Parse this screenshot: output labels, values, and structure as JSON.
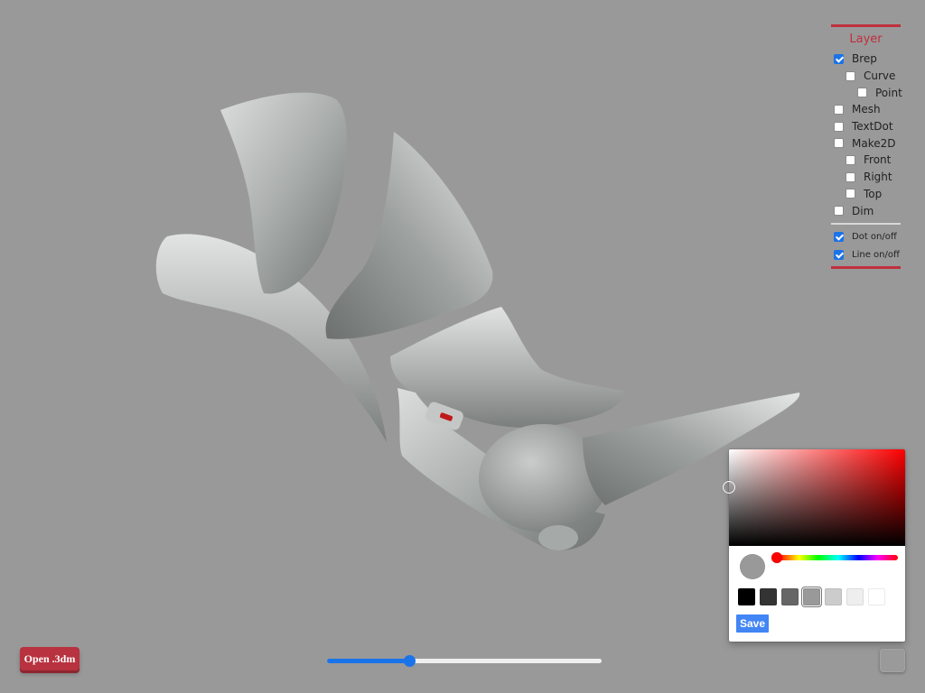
{
  "layer_panel": {
    "title": "Layer",
    "layers": [
      {
        "label": "Brep",
        "checked": true,
        "level": 0
      },
      {
        "label": "Curve",
        "checked": false,
        "level": 1
      },
      {
        "label": "Point",
        "checked": false,
        "level": 2
      },
      {
        "label": "Mesh",
        "checked": false,
        "level": 0
      },
      {
        "label": "TextDot",
        "checked": false,
        "level": 0
      },
      {
        "label": "Make2D",
        "checked": false,
        "level": 0
      },
      {
        "label": "Front",
        "checked": false,
        "level": 1
      },
      {
        "label": "Right",
        "checked": false,
        "level": 1
      },
      {
        "label": "Top",
        "checked": false,
        "level": 1
      },
      {
        "label": "Dim",
        "checked": false,
        "level": 0
      }
    ],
    "toggles": [
      {
        "label": "Dot on/off",
        "checked": true
      },
      {
        "label": "Line on/off",
        "checked": true
      }
    ]
  },
  "color_picker": {
    "hue_color": "#ff0000",
    "current_color": "#999999",
    "swatches": [
      "#000000",
      "#333333",
      "#666666",
      "#999999",
      "#cccccc",
      "#eeeeee",
      "#ffffff"
    ],
    "selected_swatch": "#999999",
    "save_label": "Save"
  },
  "open_button": {
    "label": "Open .3dm"
  },
  "slider": {
    "value_fraction": 0.3
  },
  "model": {
    "name": "rhino-logo-model",
    "background_color": "#999999"
  }
}
